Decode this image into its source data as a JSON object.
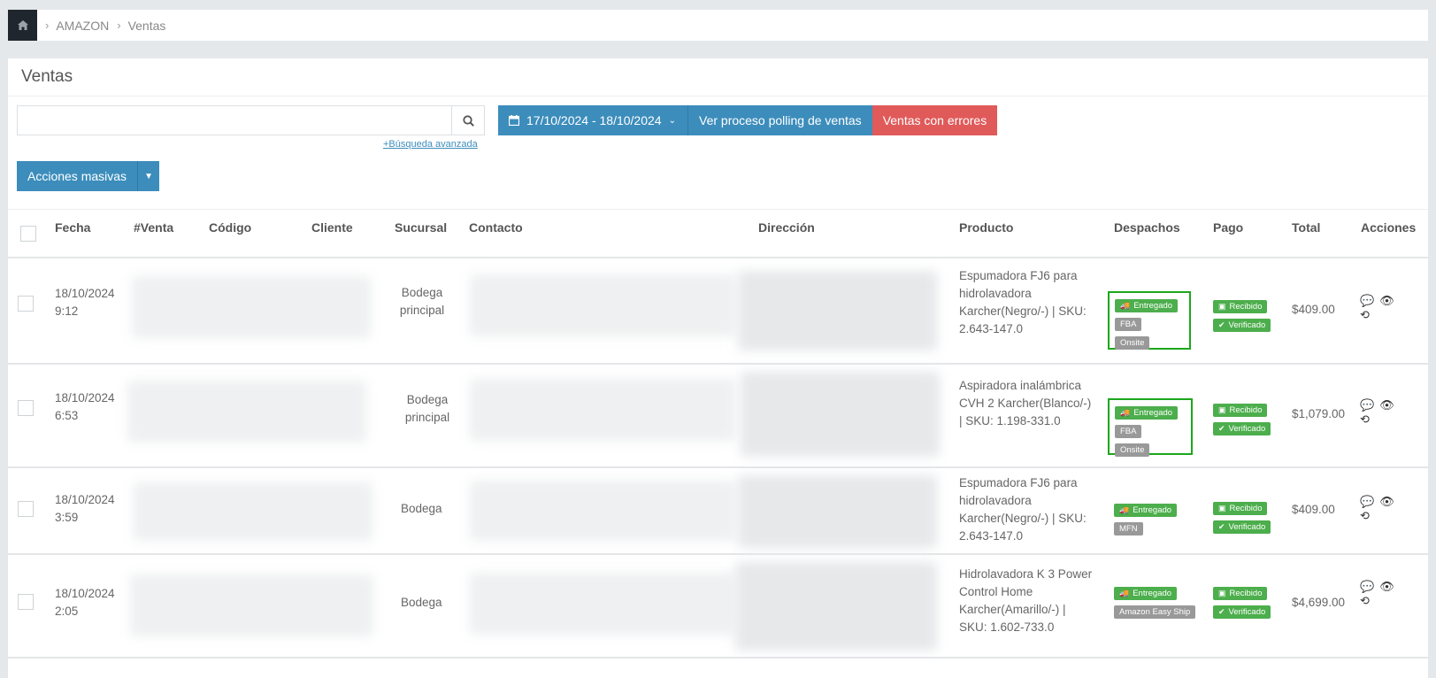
{
  "breadcrumb": {
    "items": [
      "AMAZON",
      "Ventas"
    ]
  },
  "page_title": "Ventas",
  "search": {
    "value": "",
    "placeholder": "",
    "advanced_link": "+Búsqueda avanzada"
  },
  "toolbar": {
    "date_range": "17/10/2024 - 18/10/2024",
    "polling_label": "Ver proceso polling de ventas",
    "errors_label": "Ventas con errores",
    "bulk_actions": "Acciones masivas"
  },
  "table": {
    "columns": [
      "Fecha",
      "#Venta",
      "Código",
      "Cliente",
      "Sucursal",
      "Contacto",
      "Dirección",
      "Producto",
      "Despachos",
      "Pago",
      "Total",
      "Acciones"
    ],
    "rows": [
      {
        "date": "18/10/2024",
        "time": "9:12",
        "sucursal": [
          "Bodega",
          "principal"
        ],
        "product": [
          "Espumadora FJ6 para",
          "hidrolavadora",
          "Karcher(Negro/-) | SKU:",
          "2.643-147.0"
        ],
        "dispatch_status": "Entregado",
        "dispatch_tags": [
          "FBA",
          "Onsite"
        ],
        "payment": [
          "Recibido",
          "Verificado"
        ],
        "total": "$409.00"
      },
      {
        "date": "18/10/2024",
        "time": "6:53",
        "sucursal": [
          "Bodega",
          "principal"
        ],
        "product": [
          "Aspiradora inalámbrica",
          "CVH 2 Karcher(Blanco/-)",
          "| SKU: 1.198-331.0"
        ],
        "dispatch_status": "Entregado",
        "dispatch_tags": [
          "FBA",
          "Onsite"
        ],
        "payment": [
          "Recibido",
          "Verificado"
        ],
        "total": "$1,079.00"
      },
      {
        "date": "18/10/2024",
        "time": "3:59",
        "sucursal": [
          "Bodega"
        ],
        "product": [
          "Espumadora FJ6 para",
          "hidrolavadora",
          "Karcher(Negro/-) | SKU:",
          "2.643-147.0"
        ],
        "dispatch_status": "Entregado",
        "dispatch_tags": [
          "MFN"
        ],
        "payment": [
          "Recibido",
          "Verificado"
        ],
        "total": "$409.00"
      },
      {
        "date": "18/10/2024",
        "time": "2:05",
        "sucursal": [
          "Bodega"
        ],
        "product": [
          "Hidrolavadora K 3 Power",
          "Control Home",
          "Karcher(Amarillo/-) |",
          "SKU: 1.602-733.0"
        ],
        "dispatch_status": "Entregado",
        "dispatch_tags": [
          "Amazon Easy Ship"
        ],
        "payment": [
          "Recibido",
          "Verificado"
        ],
        "total": "$4,699.00"
      }
    ]
  },
  "icons": {
    "home": "home-icon",
    "search": "search-icon",
    "calendar": "calendar-icon",
    "truck": "truck-icon",
    "money": "money-icon",
    "check": "check-icon",
    "comment": "comment-icon",
    "eye": "eye-icon",
    "history": "history-icon"
  },
  "colors": {
    "primary": "#3c8dbc",
    "danger": "#e05a5a",
    "success": "#4cae4c",
    "highlight_border": "#1ca71c"
  }
}
